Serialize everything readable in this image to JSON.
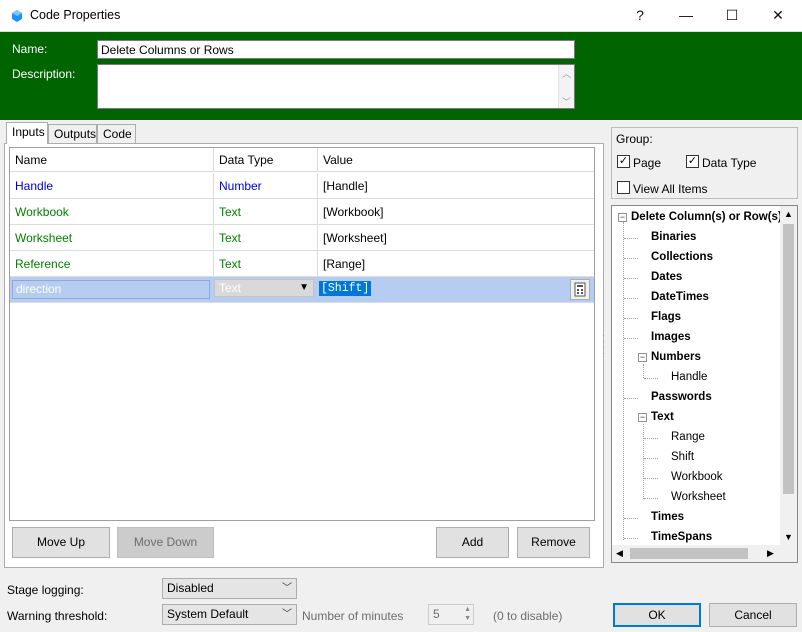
{
  "window": {
    "title": "Code Properties",
    "help": "?",
    "minimize": "—",
    "maximize": "☐",
    "close": "✕"
  },
  "header": {
    "name_label": "Name:",
    "name_value": "Delete Columns or Rows",
    "description_label": "Description:",
    "description_value": ""
  },
  "tabs": [
    {
      "label": "Inputs",
      "active": true
    },
    {
      "label": "Outputs"
    },
    {
      "label": "Code"
    }
  ],
  "grid": {
    "columns": [
      "Name",
      "Data Type",
      "Value"
    ],
    "rows": [
      {
        "name": "Handle",
        "type": "Number",
        "value": "[Handle]",
        "color": "#0000cc"
      },
      {
        "name": "Workbook",
        "type": "Text",
        "value": "[Workbook]",
        "color": "#008000"
      },
      {
        "name": "Worksheet",
        "type": "Text",
        "value": "[Worksheet]",
        "color": "#008000"
      },
      {
        "name": "Reference",
        "type": "Text",
        "value": "[Range]",
        "color": "#008000"
      }
    ],
    "edit_row": {
      "name": "direction",
      "type": "Text",
      "value": "[Shift]"
    }
  },
  "buttons": {
    "move_up": "Move Up",
    "move_down": "Move Down",
    "add": "Add",
    "remove": "Remove",
    "ok": "OK",
    "cancel": "Cancel"
  },
  "group": {
    "label": "Group:",
    "page": "Page",
    "data_type": "Data Type",
    "view_all": "View All Items"
  },
  "tree": {
    "root": "Delete Column(s) or Row(s)",
    "items": [
      "Binaries",
      "Collections",
      "Dates",
      "DateTimes",
      "Flags",
      "Images",
      "Numbers",
      "Handle",
      "Passwords",
      "Text",
      "Range",
      "Shift",
      "Workbook",
      "Worksheet",
      "Times",
      "TimeSpans"
    ]
  },
  "bottom": {
    "stage_logging_label": "Stage logging:",
    "stage_logging_value": "Disabled",
    "warning_label": "Warning threshold:",
    "warning_value": "System Default",
    "minutes_label": "Number of minutes",
    "minutes_value": "5",
    "zero_hint": "(0 to disable)"
  },
  "colors": {
    "header_green": "#006400",
    "selection": "#b6cdf1",
    "accent_blue": "#0078d7"
  }
}
